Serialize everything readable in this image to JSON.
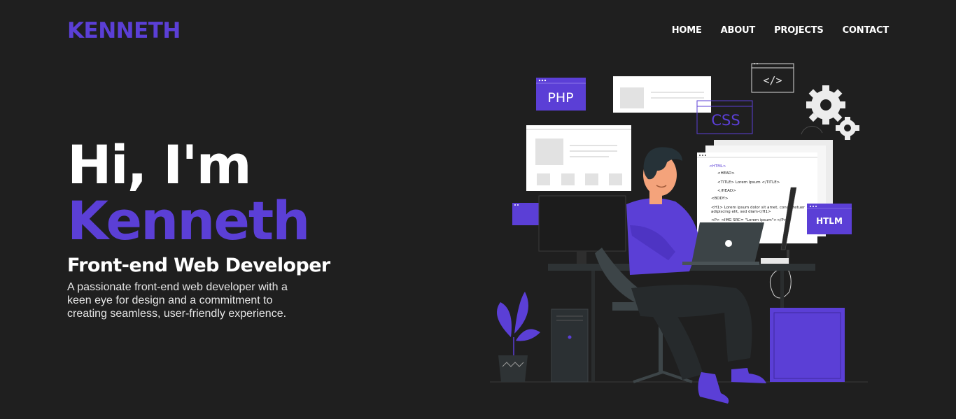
{
  "header": {
    "logo": "KENNETH",
    "nav": [
      {
        "label": "HOME"
      },
      {
        "label": "ABOUT"
      },
      {
        "label": "PROJECTS"
      },
      {
        "label": "CONTACT"
      }
    ]
  },
  "hero": {
    "greeting": "Hi, I'm",
    "name": "Kenneth",
    "role": "Front-end Web Developer",
    "description": "A passionate front-end web developer with a keen eye for design and a commitment to creating seamless, user-friendly experience."
  },
  "illustration": {
    "php_label": "PHP",
    "css_label": "CSS",
    "html_badge": "HTLM",
    "code_symbol": "</>",
    "code_lines": [
      "<HTML>",
      "<HEAD>",
      "<TITLE> Lorem Ipsum </TITLE>",
      "</HEAD>",
      "<BODY>",
      "<H1> Lorem ipsum dolor sit amet, consectetuer",
      "adipiscing elit, sed diam</H1>",
      "<P> <IMG SRC= \"Lorem ipsum\"></P>"
    ]
  },
  "colors": {
    "background": "#1f1f1f",
    "accent": "#5b3fd6",
    "text": "#ffffff"
  }
}
